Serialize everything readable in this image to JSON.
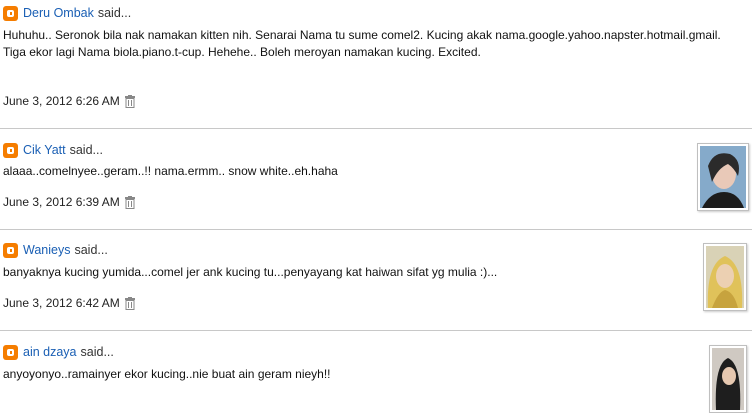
{
  "comments": [
    {
      "author": "Deru Ombak",
      "said": "said...",
      "text": "Huhuhu.. Seronok bila nak namakan kitten nih. Senarai Nama tu sume comel2. Kucing akak nama.google.yahoo.napster.hotmail.gmail. Tiga ekor lagi Nama biola.piano.t-cup. Hehehe.. Boleh meroyan namakan kucing. Excited.",
      "timestamp": "June 3, 2012 6:26 AM"
    },
    {
      "author": "Cik Yatt",
      "said": "said...",
      "text": "alaaa..comelnyee..geram..!! nama.ermm.. snow white..eh.haha",
      "timestamp": "June 3, 2012 6:39 AM"
    },
    {
      "author": "Wanieys",
      "said": "said...",
      "text": "banyaknya kucing yumida...comel jer ank kucing tu...penyayang kat haiwan sifat yg mulia :)...",
      "timestamp": "June 3, 2012 6:42 AM"
    },
    {
      "author": "ain dzaya",
      "said": "said...",
      "text": "anyoyonyo..ramainyer ekor kucing..nie buat ain geram nieyh!!",
      "timestamp": ""
    }
  ],
  "colors": {
    "link": "#1a5fb4",
    "blogger_icon": "#f57d00",
    "divider": "#c8c8c8"
  },
  "icons": {
    "blogger": "blogger-icon",
    "delete": "trash-icon"
  }
}
